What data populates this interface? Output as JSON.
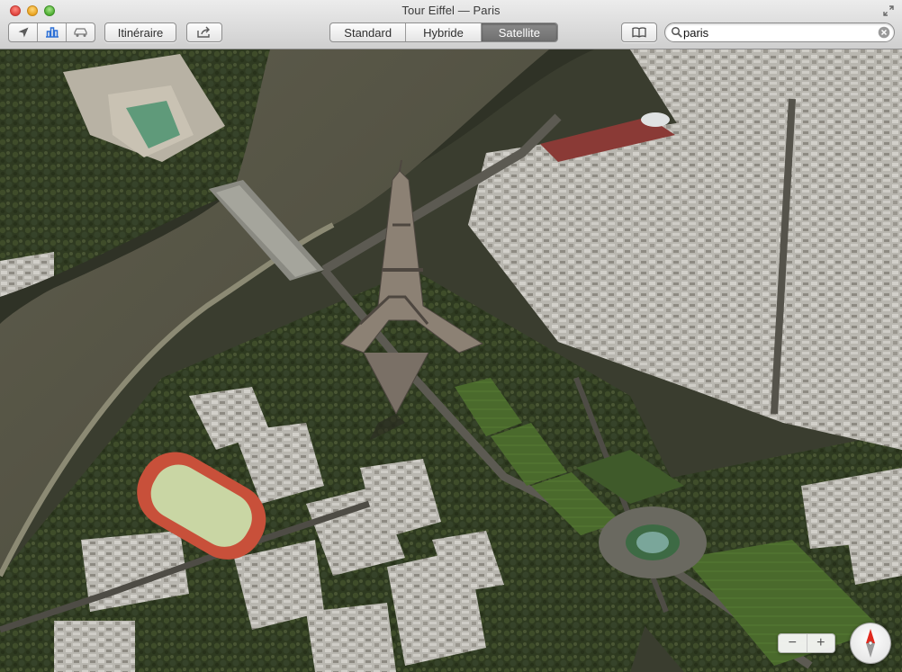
{
  "window": {
    "title": "Tour Eiffel — Paris"
  },
  "toolbar": {
    "location_icon": "location-arrow-icon",
    "three_d_icon": "3d-buildings-icon",
    "traffic_icon": "car-traffic-icon",
    "directions_label": "Itinéraire",
    "share_icon": "share-icon",
    "map_modes": [
      {
        "label": "Standard",
        "active": false
      },
      {
        "label": "Hybride",
        "active": false
      },
      {
        "label": "Satellite",
        "active": true
      }
    ],
    "bookmarks_icon": "book-icon"
  },
  "search": {
    "value": "paris",
    "icon": "magnifier-icon",
    "clear_icon": "clear-circle-icon"
  },
  "map": {
    "zoom_out": "−",
    "zoom_in": "+",
    "compass_icon": "compass-icon"
  },
  "colors": {
    "active_segment": "#7c7c7c",
    "river": "#5a5848",
    "track": "#c8503a",
    "compass_red": "#e02a1f"
  }
}
